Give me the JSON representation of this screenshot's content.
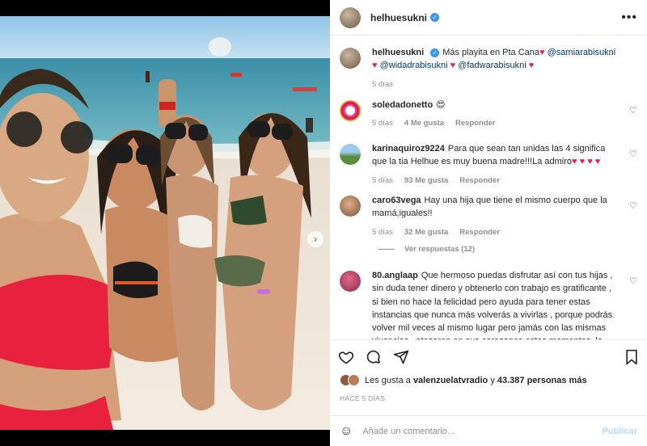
{
  "post": {
    "username": "helhuesukni",
    "verified_icon": "verified-badge-icon",
    "more_icon": "more-options-icon"
  },
  "caption": {
    "username": "helhuesukni",
    "text": "Más playita en Pta Cana",
    "heart": "♥",
    "mention_1": "@samiarabisukni",
    "mention_2": "@widadrabisukni",
    "mention_3": "@fadwarabisukni",
    "time": "5 días"
  },
  "comments": [
    {
      "username": "soledadonetto",
      "text": "😍",
      "time": "5 días",
      "likes": "4 Me gusta",
      "reply": "Responder"
    },
    {
      "username": "karinaquiroz9224",
      "text": "Para que sean tan unidas las 4 significa que la tia Helhue es muy buena madre!!!La admiro",
      "hearts": "♥ ♥ ♥ ♥",
      "time": "5 días",
      "likes": "93 Me gusta",
      "reply": "Responder"
    },
    {
      "username": "caro63vega",
      "text": "Hay una hija que tiene el mismo cuerpo que la mamá,iguales!!",
      "time": "5 días",
      "likes": "32 Me gusta",
      "reply": "Responder",
      "view_replies": "Ver respuestas (12)"
    },
    {
      "username": "80.anglaap",
      "text": "Que hermoso puedas disfrutar así con tus hijas , sin duda tener dinero y obtenerlo con trabajo es gratificante , si bien no hace la felicidad pero ayuda para tener estas instancias que nunca más volverás a vivirlas , porque podrás volver mil veces al mismo lugar pero jamás con las mismas vivencias , atesoren en sus corazones estos momentos, la vida"
    }
  ],
  "likes_line": {
    "prefix": "Les gusta a",
    "user": "valenzuelatvradio",
    "middle": "y",
    "count": "43.387 personas más"
  },
  "posted": "HACE 5 DÍAS",
  "add_comment": {
    "placeholder": "Añade un comentario...",
    "publish": "Publicar"
  },
  "colors": {
    "accent": "#3897f0",
    "heart": "#e0245e",
    "publish_disabled": "#b3dbff",
    "muted": "#8e8e8e"
  }
}
